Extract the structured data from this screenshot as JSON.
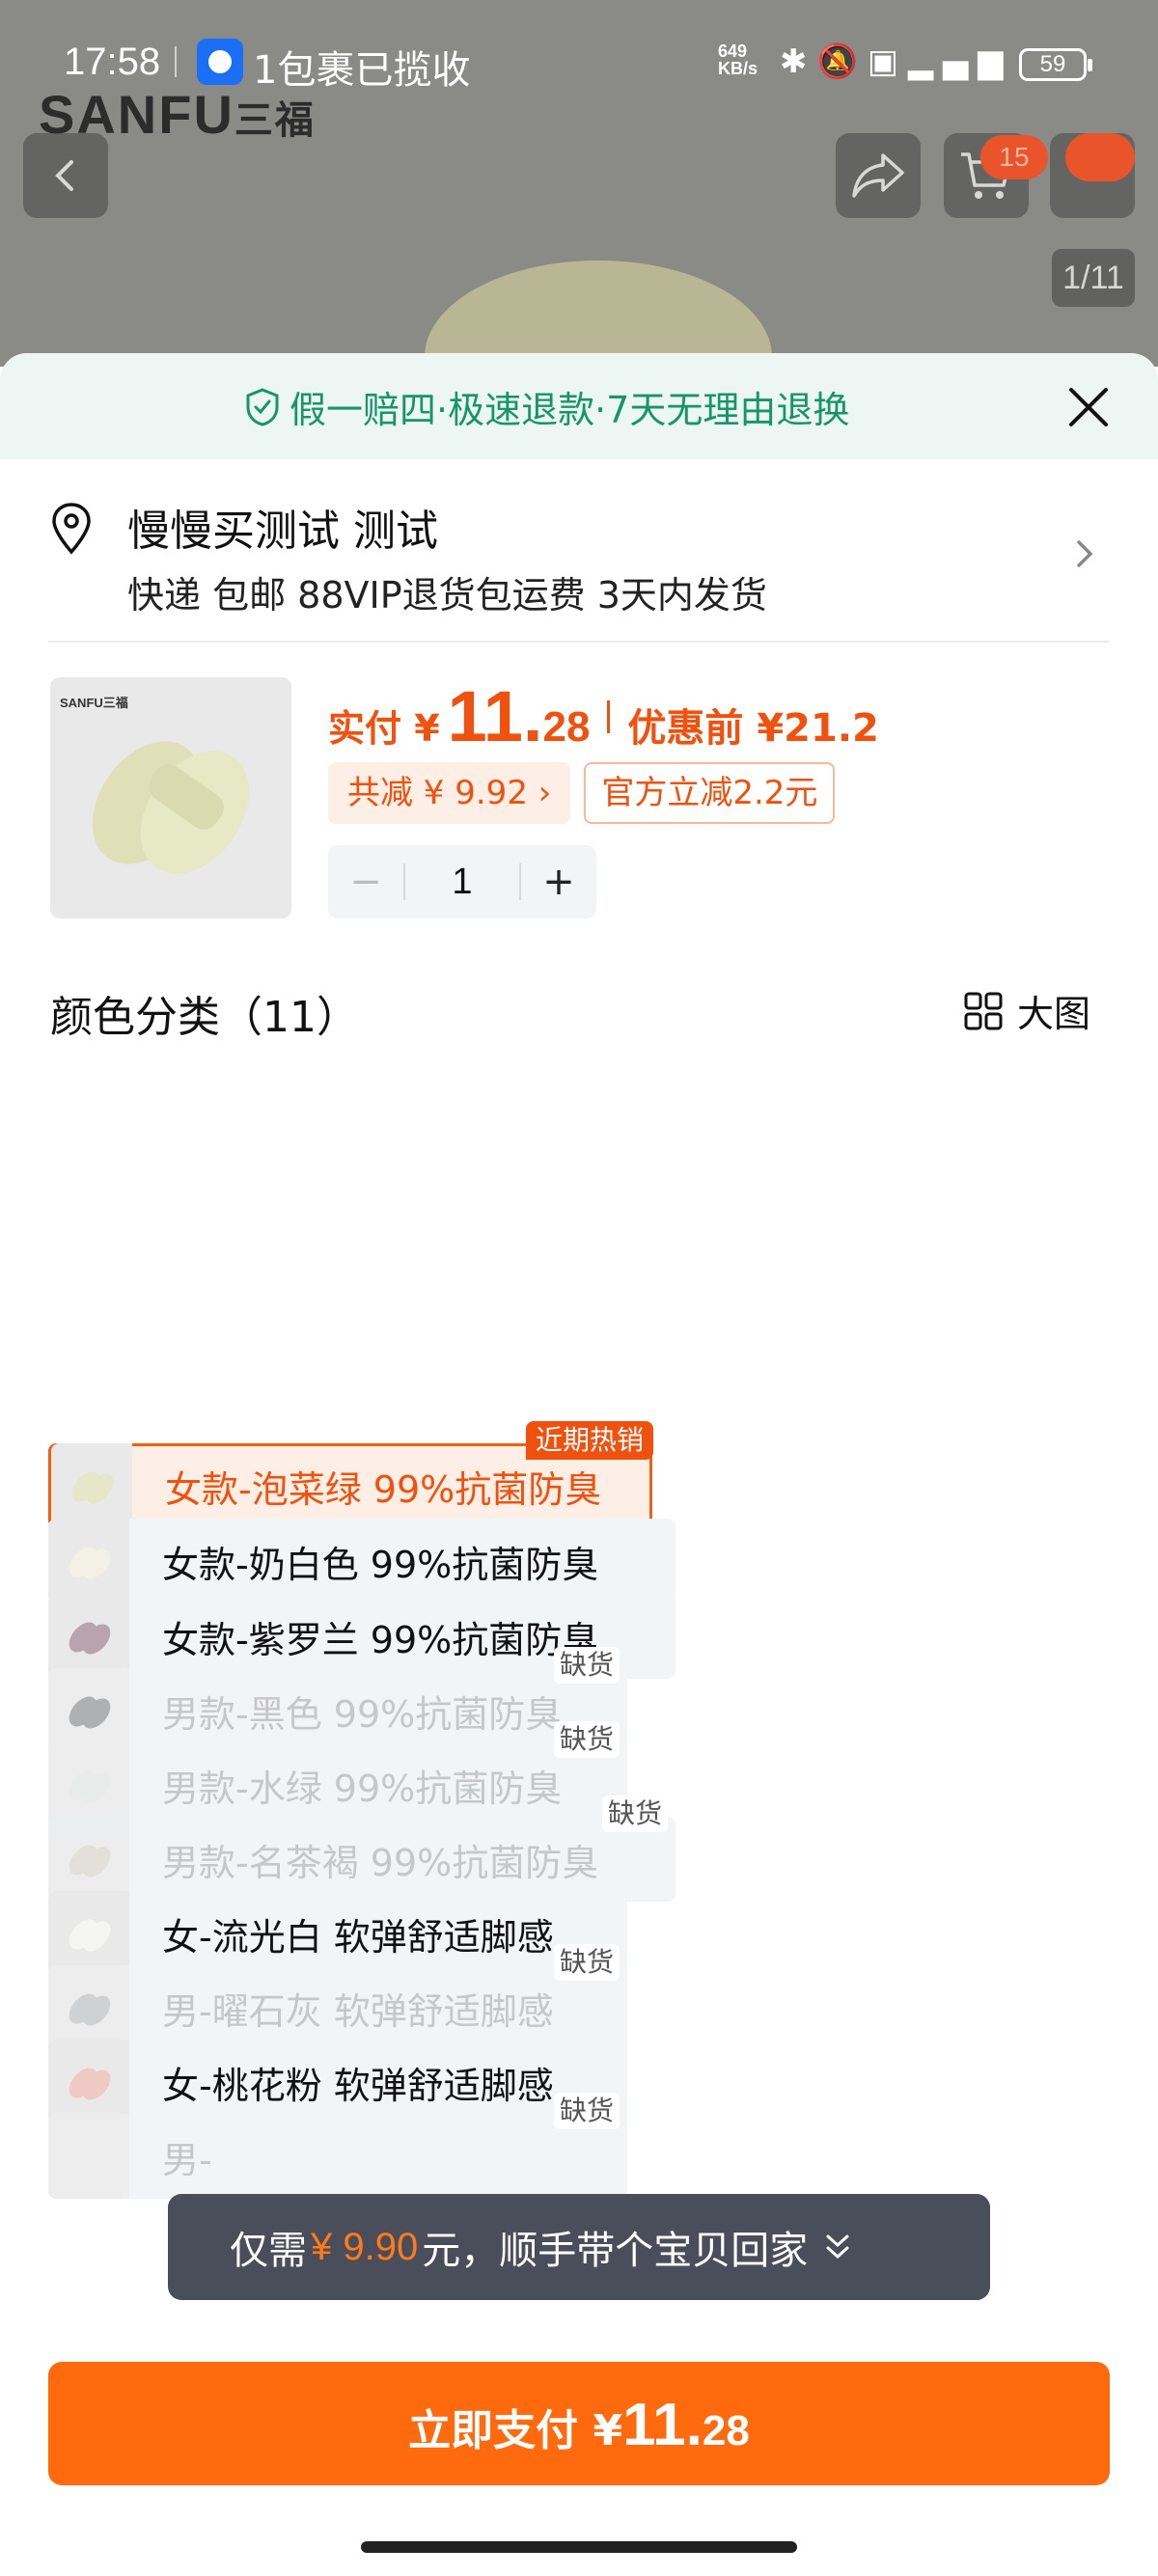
{
  "status_bar": {
    "time": "17:58",
    "notification": "1包裹已揽收",
    "net_speed": "649",
    "net_unit": "KB/s",
    "battery": "59",
    "icons": [
      "bluetooth-icon",
      "mute-icon",
      "hd-icon",
      "5g-signal-icon"
    ]
  },
  "background": {
    "brand_main": "SANFU",
    "brand_cn": "三福",
    "cart_badge": "15",
    "image_counter": "1/11"
  },
  "sheet": {
    "guarantee": "假一赔四·极速退款·7天无理由退换",
    "address": {
      "name": "慢慢买测试 测试",
      "shipping": "快递 包邮 88VIP退货包运费 3天内发货"
    },
    "product": {
      "thumb_logo": "SANFU三福",
      "pay_label": "实付 ¥",
      "price_int": "11.",
      "price_dec": "28",
      "before_label": "优惠前 ¥21.2",
      "total_save": "共减 ¥ 9.92 ›",
      "official_offer": "官方立减2.2元",
      "quantity": "1",
      "minus": "−",
      "plus": "+"
    },
    "options_title": "颜色分类（11）",
    "big_view": "大图",
    "hot_tag": "近期热销",
    "oos_tag": "缺货",
    "options": [
      {
        "label": "女款-泡菜绿 99%抗菌防臭",
        "state": "selected",
        "color": "#e6e7c8"
      },
      {
        "label": "女款-奶白色 99%抗菌防臭",
        "state": "normal",
        "color": "#f3f0e6"
      },
      {
        "label": "女款-紫罗兰 99%抗菌防臭",
        "state": "normal",
        "color": "#b9a4ad"
      },
      {
        "label": "男款-黑色 99%抗菌防臭",
        "state": "disabled",
        "color": "#7a7a7a"
      },
      {
        "label": "男款-水绿 99%抗菌防臭",
        "state": "disabled",
        "color": "#e0e5e0"
      },
      {
        "label": "男款-名茶褐 99%抗菌防臭",
        "state": "disabled",
        "color": "#d8d0c2"
      },
      {
        "label": "女-流光白 软弹舒适脚感",
        "state": "normal",
        "color": "#f5f5f3"
      },
      {
        "label": "男-曜石灰 软弹舒适脚感",
        "state": "disabled",
        "color": "#b5b5b5"
      },
      {
        "label": "女-桃花粉 软弹舒适脚感",
        "state": "normal",
        "color": "#efc9c4"
      },
      {
        "label": "男-",
        "state": "disabled",
        "color": "#e9e9e9"
      }
    ],
    "toast": {
      "prefix": "仅需",
      "price": "¥ 9.90",
      "suffix": "元，顺手带个宝贝回家"
    },
    "pay_button": {
      "label": "立即支付 ¥",
      "int": "11.",
      "dec": "28"
    }
  },
  "colors": {
    "accent": "#f0510e",
    "pay_button": "#ff6a0f",
    "guarantee_green": "#16956b"
  }
}
